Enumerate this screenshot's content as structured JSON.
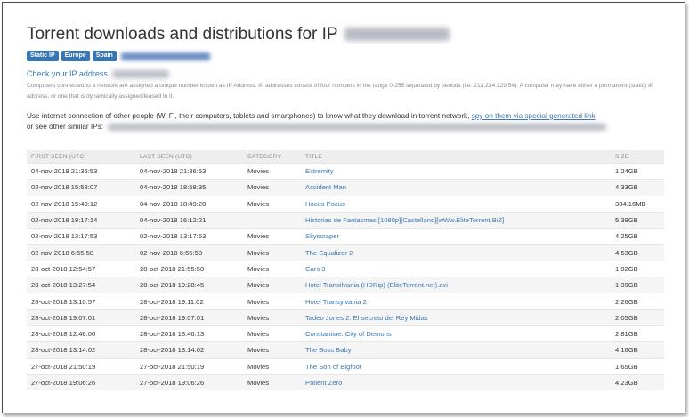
{
  "page": {
    "title": "Torrent downloads and distributions for IP",
    "badges": [
      "Static IP",
      "Europe",
      "Spain"
    ],
    "check_link": "Check your IP address",
    "description": "Computers connected to a network are assigned a unique number known as IP Address. IP addresses consist of four numbers in the range 0-255 separated by periods (i.e. 213.234.129.54). A computer may have either a permanent (static) IP address, or one that is dynamically assigned/leased to it.",
    "use_text": "Use internet connection of other people (Wi Fi, their computers, tablets and smartphones) to know what they download in torrent network,",
    "use_link": "spy on them via special generated link",
    "use_text_2": "or see other similar IPs:"
  },
  "table": {
    "headers": [
      "FIRST SEEN (UTC)",
      "LAST SEEN (UTC)",
      "CATEGORY",
      "TITLE",
      "SIZE"
    ],
    "rows": [
      [
        "04-nov-2018 21:36:53",
        "04-nov-2018 21:36:53",
        "Movies",
        "Extremity",
        "1.24GB"
      ],
      [
        "02-nov-2018 15:58:07",
        "04-nov-2018 18:58:35",
        "Movies",
        "Accident Man",
        "4.33GB"
      ],
      [
        "02-nov-2018 15:49:12",
        "04-nov-2018 18:49:20",
        "Movies",
        "Hocus Pocus",
        "384.16MB"
      ],
      [
        "02-nov-2018 19:17:14",
        "04-nov-2018 16:12:21",
        "",
        "Historias de Fantasmas [1080p][Castellano][wWw.EliteTorrent.BiZ]",
        "5.39GB"
      ],
      [
        "02-nov-2018 13:17:53",
        "02-nov-2018 13:17:53",
        "Movies",
        "Skyscraper",
        "4.25GB"
      ],
      [
        "02-nov-2018 6:55:58",
        "02-nov-2018 6:55:58",
        "Movies",
        "The Equalizer 2",
        "4.53GB"
      ],
      [
        "28-oct-2018 12:54:57",
        "28-oct-2018 21:55:50",
        "Movies",
        "Cars 3",
        "1.92GB"
      ],
      [
        "28-oct-2018 13:27:54",
        "28-oct-2018 19:28:45",
        "Movies",
        "Hotel Transilvania (HDRip) (EliteTorrent.net).avi",
        "1.39GB"
      ],
      [
        "28-oct-2018 13:10:57",
        "28-oct-2018 19:11:02",
        "Movies",
        "Hotel Transylvania 2",
        "2.26GB"
      ],
      [
        "28-oct-2018 19:07:01",
        "28-oct-2018 19:07:01",
        "Movies",
        "Tadeo Jones 2: El secreto del Rey Midas",
        "2.05GB"
      ],
      [
        "28-oct-2018 12:46:00",
        "28-oct-2018 18:46:13",
        "Movies",
        "Constantine: City of Demons",
        "2.81GB"
      ],
      [
        "28-oct-2018 13:14:02",
        "28-oct-2018 13:14:02",
        "Movies",
        "The Boss Baby",
        "4.16GB"
      ],
      [
        "27-oct-2018 21:50:19",
        "27-oct-2018 21:50:19",
        "Movies",
        "The Son of Bigfoot",
        "1.65GB"
      ],
      [
        "27-oct-2018 19:06:26",
        "27-oct-2018 19:06:26",
        "Movies",
        "Patient Zero",
        "4.23GB"
      ]
    ]
  },
  "colors": {
    "link": "#3a76b2",
    "badge": "#3a76b2",
    "header_bg": "#eeeeee"
  }
}
